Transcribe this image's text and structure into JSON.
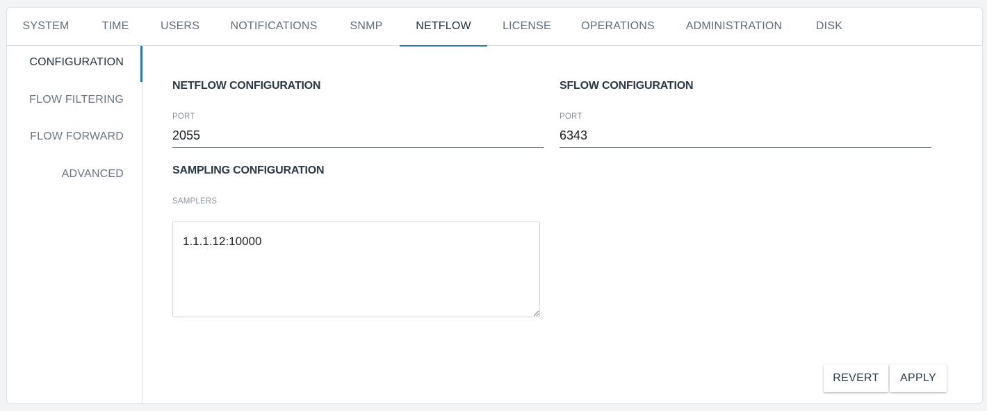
{
  "tabs": [
    {
      "label": "SYSTEM"
    },
    {
      "label": "TIME"
    },
    {
      "label": "USERS"
    },
    {
      "label": "NOTIFICATIONS"
    },
    {
      "label": "SNMP"
    },
    {
      "label": "NETFLOW"
    },
    {
      "label": "LICENSE"
    },
    {
      "label": "OPERATIONS"
    },
    {
      "label": "ADMINISTRATION"
    },
    {
      "label": "DISK"
    }
  ],
  "active_tab": "NETFLOW",
  "sidebar": {
    "items": [
      {
        "label": "CONFIGURATION"
      },
      {
        "label": "FLOW FILTERING"
      },
      {
        "label": "FLOW FORWARD"
      },
      {
        "label": "ADVANCED"
      }
    ],
    "active": "CONFIGURATION"
  },
  "netflow": {
    "title": "NETFLOW CONFIGURATION",
    "port_label": "PORT",
    "port_value": "2055"
  },
  "sflow": {
    "title": "SFLOW CONFIGURATION",
    "port_label": "PORT",
    "port_value": "6343"
  },
  "sampling": {
    "title": "SAMPLING CONFIGURATION",
    "samplers_label": "SAMPLERS",
    "samplers_value": "1.1.1.12:10000"
  },
  "actions": {
    "revert_label": "REVERT",
    "apply_label": "APPLY"
  },
  "colors": {
    "accent": "#2f6fc0",
    "border": "#dcdfe3"
  }
}
